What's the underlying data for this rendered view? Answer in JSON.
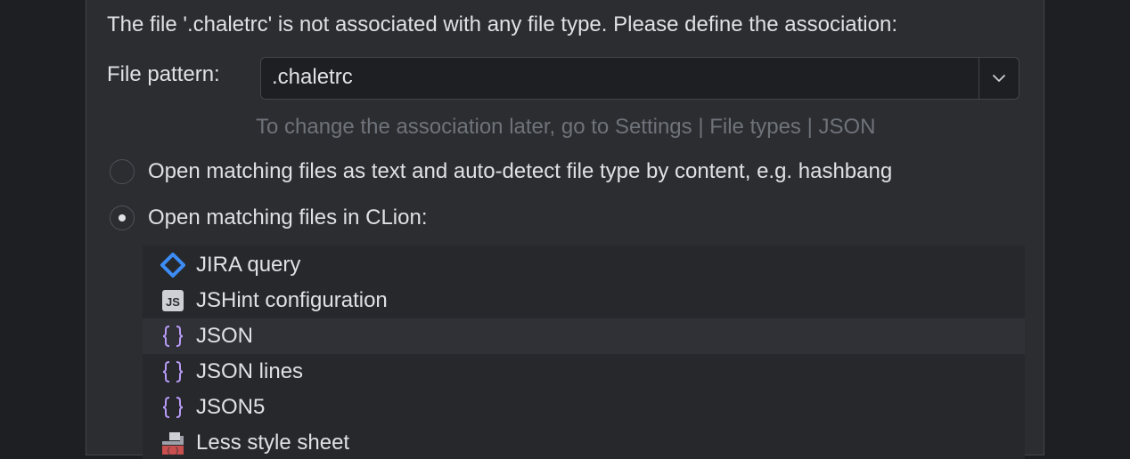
{
  "dialog": {
    "message": "The file '.chaletrc' is not associated with any file type. Please define the association:",
    "pattern_label": "File pattern:",
    "pattern_value": ".chaletrc",
    "hint": "To change the association later, go to Settings | File types | JSON"
  },
  "options": {
    "text_option": "Open matching files as text and auto-detect file type by content, e.g. hashbang",
    "clion_option": "Open matching files in CLion:",
    "selected": "clion_option"
  },
  "file_types": {
    "items": [
      {
        "label": "JIRA query",
        "icon": "jira-diamond-icon"
      },
      {
        "label": "JSHint configuration",
        "icon": "jshint-icon"
      },
      {
        "label": "JSON",
        "icon": "json-braces-icon"
      },
      {
        "label": "JSON lines",
        "icon": "json-braces-icon"
      },
      {
        "label": "JSON5",
        "icon": "json-braces-icon"
      },
      {
        "label": "Less style sheet",
        "icon": "less-icon"
      }
    ],
    "selected": "JSON",
    "jshint_badge": "JS"
  },
  "colors": {
    "background": "#1e1f22",
    "dialog": "#2b2d30",
    "text": "#dfe1e5",
    "hint": "#6f737a",
    "jira_blue": "#3d8cf5",
    "json_purple": "#b99bf8",
    "less_red": "#c94f4f"
  }
}
